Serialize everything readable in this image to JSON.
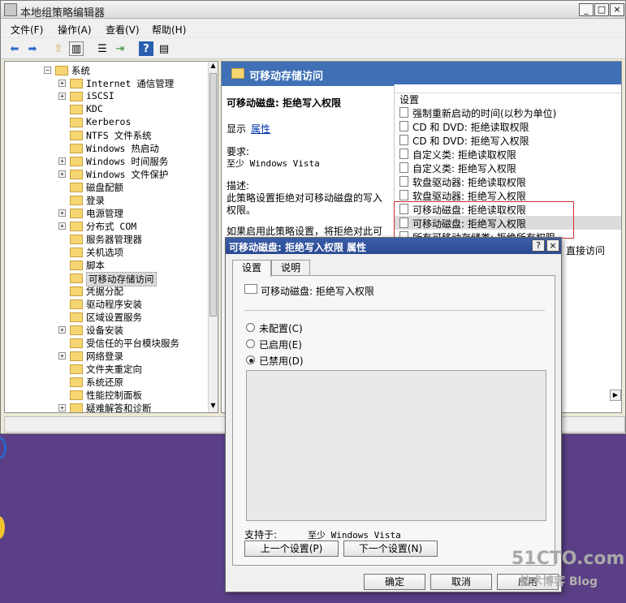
{
  "window": {
    "title": "本地组策略编辑器",
    "buttons": [
      "_",
      "□",
      "×"
    ]
  },
  "menu": [
    "文件(F)",
    "操作(A)",
    "查看(V)",
    "帮助(H)"
  ],
  "toolbar_icons": [
    "back-icon",
    "forward-icon",
    "up-folder-icon",
    "show-hide-tree-icon",
    "properties-icon",
    "export-icon",
    "help-icon",
    "filter-icon"
  ],
  "tree": [
    {
      "label": "系统",
      "level": 0,
      "expander": "−"
    },
    {
      "label": "Internet 通信管理",
      "level": 1,
      "expander": "+"
    },
    {
      "label": "iSCSI",
      "level": 1,
      "expander": "+"
    },
    {
      "label": "KDC",
      "level": 1,
      "expander": ""
    },
    {
      "label": "Kerberos",
      "level": 1,
      "expander": ""
    },
    {
      "label": "NTFS 文件系统",
      "level": 1,
      "expander": ""
    },
    {
      "label": "Windows 热启动",
      "level": 1,
      "expander": ""
    },
    {
      "label": "Windows 时间服务",
      "level": 1,
      "expander": "+"
    },
    {
      "label": "Windows 文件保护",
      "level": 1,
      "expander": "+"
    },
    {
      "label": "磁盘配额",
      "level": 1,
      "expander": ""
    },
    {
      "label": "登录",
      "level": 1,
      "expander": ""
    },
    {
      "label": "电源管理",
      "level": 1,
      "expander": "+"
    },
    {
      "label": "分布式 COM",
      "level": 1,
      "expander": "+"
    },
    {
      "label": "服务器管理器",
      "level": 1,
      "expander": ""
    },
    {
      "label": "关机选项",
      "level": 1,
      "expander": ""
    },
    {
      "label": "脚本",
      "level": 1,
      "expander": ""
    },
    {
      "label": "可移动存储访问",
      "level": 1,
      "expander": "",
      "selected": true
    },
    {
      "label": "凭据分配",
      "level": 1,
      "expander": ""
    },
    {
      "label": "驱动程序安装",
      "level": 1,
      "expander": ""
    },
    {
      "label": "区域设置服务",
      "level": 1,
      "expander": ""
    },
    {
      "label": "设备安装",
      "level": 1,
      "expander": "+"
    },
    {
      "label": "受信任的平台模块服务",
      "level": 1,
      "expander": ""
    },
    {
      "label": "网络登录",
      "level": 1,
      "expander": "+"
    },
    {
      "label": "文件夹重定向",
      "level": 1,
      "expander": ""
    },
    {
      "label": "系统还原",
      "level": 1,
      "expander": ""
    },
    {
      "label": "性能控制面板",
      "level": 1,
      "expander": ""
    },
    {
      "label": "疑难解答和诊断",
      "level": 1,
      "expander": "+"
    }
  ],
  "right_pane": {
    "header": "可移动存储访问",
    "policy_name": "可移动磁盘: 拒绝写入权限",
    "display_label": "显示",
    "properties_link": "属性",
    "req_label": "要求:",
    "req_value": "至少 Windows Vista",
    "desc_label": "描述:",
    "desc_line1": "此策略设置拒绝对可移动磁盘的写入",
    "desc_line2": "权限。",
    "if_text": "如果启用此策略设置，将拒绝对此可",
    "settings_header": "设置",
    "settings": [
      "强制重新启动的时间(以秒为单位)",
      "CD 和 DVD: 拒绝读取权限",
      "CD 和 DVD: 拒绝写入权限",
      "自定义类: 拒绝读取权限",
      "自定义类: 拒绝写入权限",
      "软盘驱动器: 拒绝读取权限",
      "软盘驱动器: 拒绝写入权限",
      "可移动磁盘: 拒绝读取权限",
      "可移动磁盘: 拒绝写入权限",
      "所有可移动存储类: 拒绝所有权限"
    ],
    "partial_text": "直接访问"
  },
  "dialog": {
    "title": "可移动磁盘: 拒绝写入权限 属性",
    "help_btn": "?",
    "close_btn": "×",
    "tabs": [
      "设置",
      "说明"
    ],
    "policy_name": "可移动磁盘: 拒绝写入权限",
    "options": [
      "未配置(C)",
      "已启用(E)",
      "已禁用(D)"
    ],
    "selected_option": "已禁用(D)",
    "supported_label": "支持于:",
    "supported_value": "至少 Windows Vista",
    "prev_btn": "上一个设置(P)",
    "next_btn": "下一个设置(N)",
    "ok_btn": "确定",
    "cancel_btn": "取消",
    "apply_btn": "应用"
  },
  "watermark": {
    "line1": "51CTO.com",
    "line2": "技术博客 Blog"
  },
  "colors": {
    "header_blue": "#3f6fb5",
    "desktop_purple": "#5a3f86",
    "highlight_red": "#d03030"
  }
}
